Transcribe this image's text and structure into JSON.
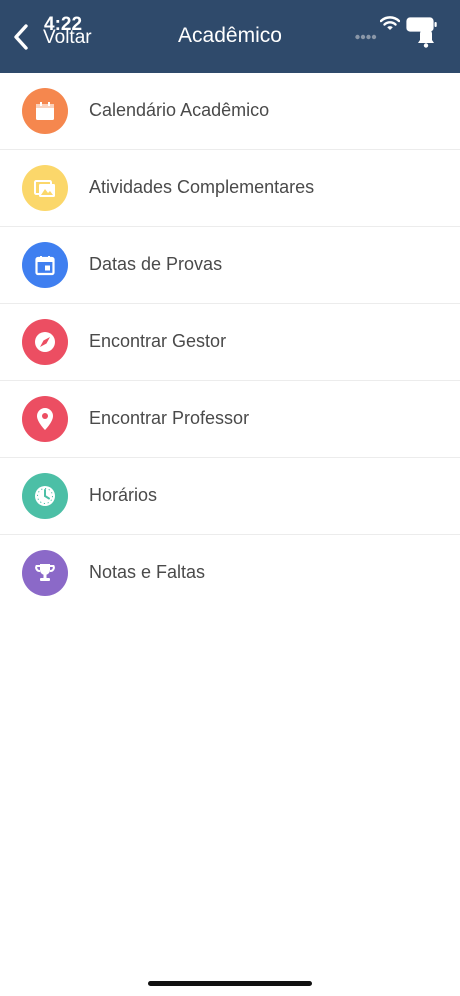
{
  "status_bar": {
    "time": "4:22"
  },
  "header": {
    "back_label": "Voltar",
    "title": "Acadêmico"
  },
  "colors": {
    "header_bg": "#2f4a6b",
    "calendar": "#f5874e",
    "activities": "#fbd76a",
    "exams": "#3f7ff0",
    "manager": "#ec4e62",
    "professor": "#ec4e62",
    "schedule": "#4cbfa6",
    "grades": "#8b69c8"
  },
  "menu": [
    {
      "label": "Calendário Acadêmico",
      "icon": "calendar-icon"
    },
    {
      "label": "Atividades Complementares",
      "icon": "images-icon"
    },
    {
      "label": "Datas de Provas",
      "icon": "event-icon"
    },
    {
      "label": "Encontrar Gestor",
      "icon": "compass-icon"
    },
    {
      "label": "Encontrar Professor",
      "icon": "location-pin-icon"
    },
    {
      "label": "Horários",
      "icon": "clock-icon"
    },
    {
      "label": "Notas e Faltas",
      "icon": "trophy-icon"
    }
  ]
}
